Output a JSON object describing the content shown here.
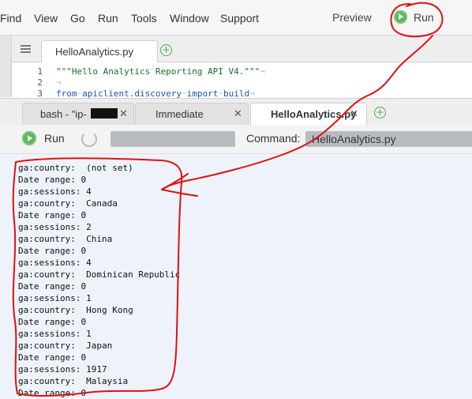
{
  "menubar": {
    "items": [
      "Find",
      "View",
      "Go",
      "Run",
      "Tools",
      "Window",
      "Support"
    ],
    "preview_label": "Preview",
    "run_label": "Run"
  },
  "editor": {
    "tab_title": "HelloAnalytics.py",
    "line_numbers": [
      "1",
      "2",
      "3"
    ],
    "lines": {
      "l1": "\"\"\"Hello Analytics Reporting API V4.\"\"\"",
      "l1_end": "¬",
      "l2": "¬",
      "l3_kw1": "from",
      "l3_mod": "apiclient.discovery",
      "l3_kw2": "import",
      "l3_name": "build",
      "l3_end": "¬"
    }
  },
  "console": {
    "tabs": [
      {
        "label": "bash - \"ip-",
        "close": "✕"
      },
      {
        "label": "Immediate",
        "close": "✕"
      },
      {
        "label": "HelloAnalytics.py",
        "close": "✕"
      }
    ],
    "run_label": "Run",
    "command_label": "Command:",
    "command_value": "HelloAnalytics.py"
  },
  "output": {
    "lines": [
      "ga:country:  (not set)",
      "Date range: 0",
      "ga:sessions: 4",
      "ga:country:  Canada",
      "Date range: 0",
      "ga:sessions: 2",
      "ga:country:  China",
      "Date range: 0",
      "ga:sessions: 4",
      "ga:country:  Dominican Republic",
      "Date range: 0",
      "ga:sessions: 1",
      "ga:country:  Hong Kong",
      "Date range: 0",
      "ga:sessions: 1",
      "ga:country:  Japan",
      "Date range: 0",
      "ga:sessions: 1917",
      "ga:country:  Malaysia",
      "Date range: 0"
    ]
  },
  "colors": {
    "run_green": "#5cb85c",
    "annotation_red": "#e01010",
    "output_bg": "#eef3fb"
  }
}
